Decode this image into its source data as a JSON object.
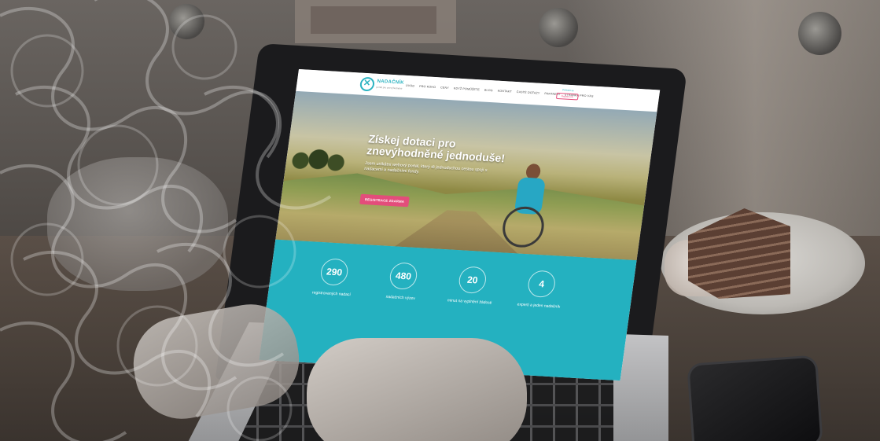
{
  "site": {
    "brand": "NADAČNÍK",
    "brand_tagline": "portál pro znevýhodněné",
    "nav": [
      "Úvod",
      "Pro koho",
      "Ceny",
      "Když pomůžete",
      "Blog",
      "Kontakt",
      "Časté dotazy",
      "Partneři",
      "Stránka pro vás"
    ],
    "nav_top_link": "Přihlásit se",
    "nav_button": "Registrovat",
    "hero": {
      "title": "Získej dotaci pro znevýhodněné jednoduše!",
      "subtitle": "Jsem unikátní webový portál, který tě jednoduchou cestou spojí s nadacemi a nadačními fondy.",
      "cta": "REGISTRACE ZDARMA"
    },
    "stats": [
      {
        "value": "290",
        "label": "registrovaných nadací"
      },
      {
        "value": "480",
        "label": "nadačních výzev"
      },
      {
        "value": "20",
        "label": "minut na vyplnění žádosti"
      },
      {
        "value": "4",
        "label": "experti a jeden nadačník"
      }
    ]
  },
  "colors": {
    "teal": "#24b1c0",
    "pink": "#e34d7b"
  }
}
